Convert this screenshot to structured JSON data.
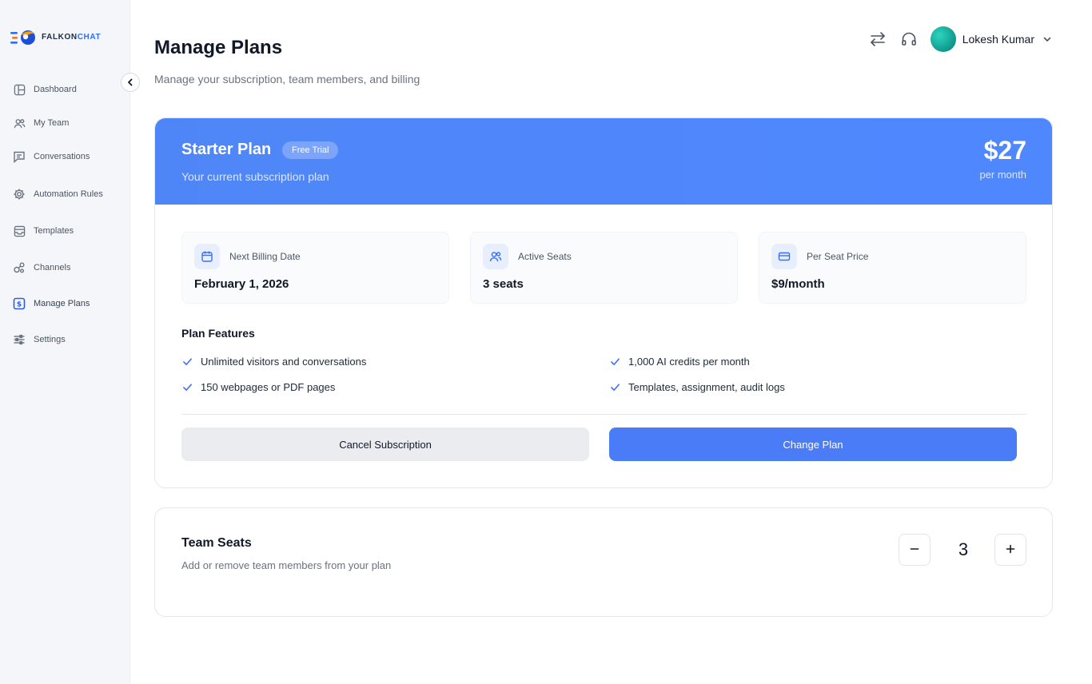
{
  "brand": {
    "name_part1": "FALKON",
    "name_part2": "CHAT",
    "accent_color": "#2f6df6"
  },
  "sidebar": {
    "items": [
      {
        "label": "Dashboard",
        "icon": "dashboard-icon"
      },
      {
        "label": "My Team",
        "icon": "team-icon"
      },
      {
        "label": "Conversations",
        "icon": "chat-icon"
      },
      {
        "label": "Automation Rules",
        "icon": "gear-icon"
      },
      {
        "label": "Templates",
        "icon": "inbox-icon"
      },
      {
        "label": "Channels",
        "icon": "channels-icon"
      },
      {
        "label": "Manage Plans",
        "icon": "billing-icon",
        "active": true
      },
      {
        "label": "Settings",
        "icon": "sliders-icon"
      }
    ]
  },
  "header": {
    "title": "Manage Plans",
    "subtitle": "Manage your subscription, team members, and billing"
  },
  "user": {
    "name": "Lokesh Kumar"
  },
  "plan": {
    "name": "Starter Plan",
    "badge": "Free Trial",
    "description": "Your current subscription plan",
    "price": "$27",
    "period": "per month",
    "header_color": "#4f86f7"
  },
  "stats": [
    {
      "label": "Next Billing Date",
      "value": "February 1, 2026",
      "icon": "calendar-icon"
    },
    {
      "label": "Active Seats",
      "value": "3 seats",
      "icon": "users-icon"
    },
    {
      "label": "Per Seat Price",
      "value": "$9/month",
      "icon": "credit-card-icon"
    }
  ],
  "features": {
    "title": "Plan Features",
    "items": [
      "Unlimited visitors and conversations",
      "1,000 AI credits per month",
      "150 webpages or PDF pages",
      "Templates, assignment, audit logs"
    ]
  },
  "actions": {
    "cancel_label": "Cancel Subscription",
    "change_label": "Change Plan",
    "primary_color": "#4a7cf7"
  },
  "seats": {
    "title": "Team Seats",
    "description": "Add or remove team members from your plan",
    "count": "3"
  }
}
